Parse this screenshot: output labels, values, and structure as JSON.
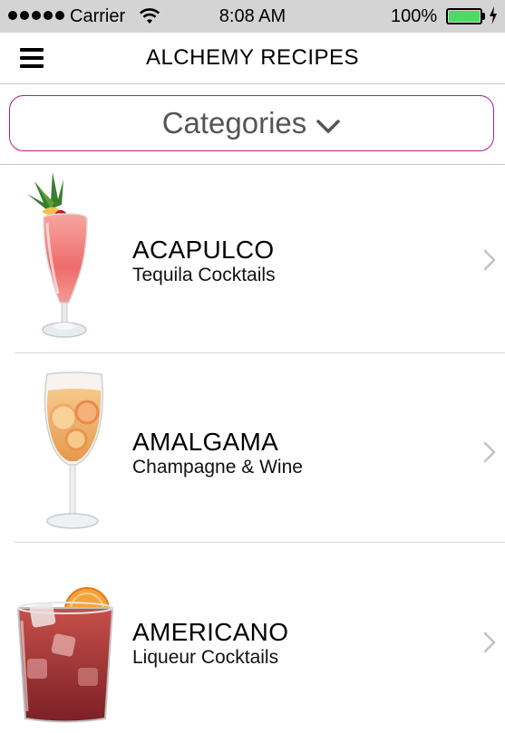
{
  "status_bar": {
    "carrier": "Carrier",
    "time": "8:08 AM",
    "battery_percent": "100%",
    "battery_level": 1.0,
    "battery_color": "#4cd964"
  },
  "nav": {
    "title": "ALCHEMY RECIPES",
    "menu_icon": "hamburger-menu-icon"
  },
  "categories": {
    "label": "Categories",
    "icon": "chevron-down-icon",
    "border_color": "#b11d86"
  },
  "recipes": [
    {
      "name": "ACAPULCO",
      "category": "Tequila Cocktails",
      "image": "hurricane-glass-cocktail"
    },
    {
      "name": "AMALGAMA",
      "category": "Champagne & Wine",
      "image": "wine-glass-sangria"
    },
    {
      "name": "AMERICANO",
      "category": "Liqueur Cocktails",
      "image": "rocks-glass-cocktail"
    }
  ]
}
